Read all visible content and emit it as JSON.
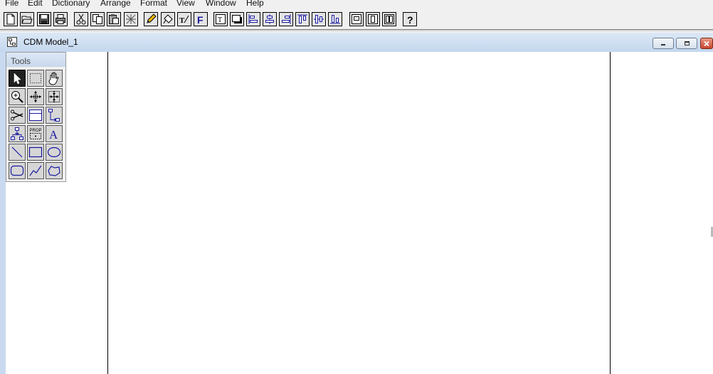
{
  "menu": {
    "items": [
      {
        "label": "File"
      },
      {
        "label": "Edit"
      },
      {
        "label": "Dictionary"
      },
      {
        "label": "Arrange"
      },
      {
        "label": "Format"
      },
      {
        "label": "View"
      },
      {
        "label": "Window"
      },
      {
        "label": "Help"
      }
    ]
  },
  "toolbar": {
    "buttons": [
      {
        "icon": "new-document-icon"
      },
      {
        "icon": "open-folder-icon"
      },
      {
        "icon": "save-icon"
      },
      {
        "icon": "print-icon"
      },
      {
        "icon": "cut-icon"
      },
      {
        "icon": "copy-icon"
      },
      {
        "icon": "paste-icon"
      },
      {
        "icon": "delete-icon"
      },
      {
        "icon": "pencil-icon"
      },
      {
        "icon": "paint-bucket-icon"
      },
      {
        "icon": "text-edit-icon"
      },
      {
        "icon": "font-icon"
      },
      {
        "icon": "text-box-icon"
      },
      {
        "icon": "shadow-icon"
      },
      {
        "icon": "align-left-icon"
      },
      {
        "icon": "align-center-icon"
      },
      {
        "icon": "align-right-icon"
      },
      {
        "icon": "align-top-icon"
      },
      {
        "icon": "align-middle-icon"
      },
      {
        "icon": "align-bottom-icon"
      },
      {
        "icon": "group-symbols-icon"
      },
      {
        "icon": "zoom-page-icon"
      },
      {
        "icon": "zoom-fit-icon"
      },
      {
        "icon": "help-icon"
      }
    ]
  },
  "window": {
    "title": "CDM Model_1",
    "controls": [
      {
        "icon": "minimize-icon"
      },
      {
        "icon": "restore-icon"
      },
      {
        "icon": "close-icon"
      }
    ]
  },
  "tools_palette": {
    "title": "Tools",
    "prop_label": "PROP",
    "tools": [
      {
        "icon": "pointer-icon",
        "active": true
      },
      {
        "icon": "lasso-select-icon"
      },
      {
        "icon": "hand-grabber-icon"
      },
      {
        "icon": "zoom-in-icon"
      },
      {
        "icon": "zoom-out-icon"
      },
      {
        "icon": "zoom-fit-icon"
      },
      {
        "icon": "scissors-icon"
      },
      {
        "icon": "entity-icon"
      },
      {
        "icon": "relationship-icon"
      },
      {
        "icon": "inheritance-icon"
      },
      {
        "icon": "properties-icon"
      },
      {
        "icon": "text-tool-icon"
      },
      {
        "icon": "line-icon"
      },
      {
        "icon": "rectangle-icon"
      },
      {
        "icon": "ellipse-icon"
      },
      {
        "icon": "rounded-rectangle-icon"
      },
      {
        "icon": "polyline-icon"
      },
      {
        "icon": "polygon-icon"
      }
    ]
  },
  "colors": {
    "title_bar": "#c9daf0",
    "canvas": "#ffffff",
    "tool_icon": "#1a1aa0",
    "active_tool": "#202020"
  }
}
